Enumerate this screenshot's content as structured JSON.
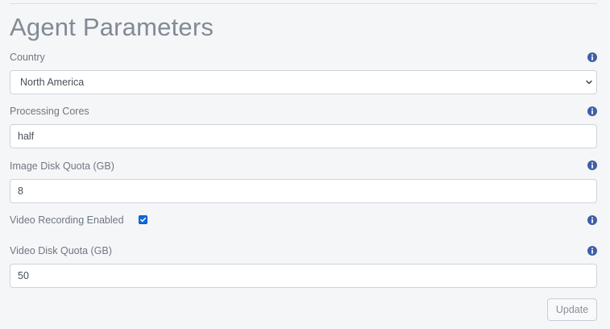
{
  "page": {
    "title": "Agent Parameters"
  },
  "form": {
    "country": {
      "label": "Country",
      "value": "North America",
      "info_icon": "info-circle-icon"
    },
    "processing_cores": {
      "label": "Processing Cores",
      "value": "half",
      "info_icon": "info-circle-icon"
    },
    "image_disk_quota": {
      "label": "Image Disk Quota (GB)",
      "value": "8",
      "info_icon": "info-circle-icon"
    },
    "video_recording": {
      "label": "Video Recording Enabled",
      "checked": true,
      "info_icon": "info-circle-icon"
    },
    "video_disk_quota": {
      "label": "Video Disk Quota (GB)",
      "value": "50",
      "info_icon": "info-circle-icon"
    },
    "update_label": "Update"
  },
  "colors": {
    "info_icon": "#3f5fa6",
    "checkbox": "#0d6ad9",
    "title": "#828a95",
    "background": "#f5f6f8"
  }
}
